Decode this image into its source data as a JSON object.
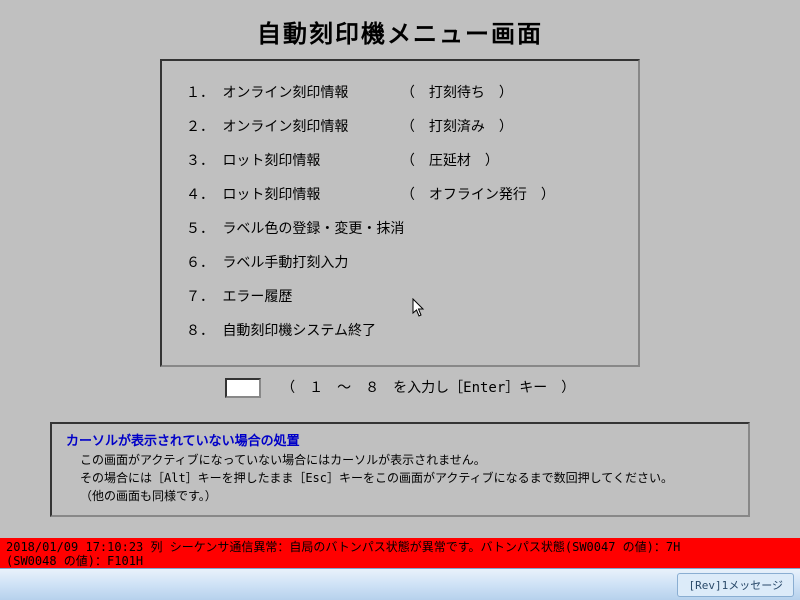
{
  "title": "自動刻印機メニュー画面",
  "menu": [
    {
      "num": "１．",
      "label": "オンライン刻印情報",
      "note": "打刻待ち"
    },
    {
      "num": "２．",
      "label": "オンライン刻印情報",
      "note": "打刻済み"
    },
    {
      "num": "３．",
      "label": "ロット刻印情報",
      "note": "圧延材"
    },
    {
      "num": "４．",
      "label": "ロット刻印情報",
      "note": "オフライン発行"
    },
    {
      "num": "５．",
      "label": "ラベル色の登録・変更・抹消",
      "note": null
    },
    {
      "num": "６．",
      "label": "ラベル手動打刻入力",
      "note": null
    },
    {
      "num": "７．",
      "label": "エラー履歴",
      "note": null
    },
    {
      "num": "８．",
      "label": "自動刻印機システム終了",
      "note": null
    }
  ],
  "input_hint": "（　１　～　８　を入力し［Enter］キー　）",
  "input_value": "",
  "help": {
    "title": "カーソルが表示されていない場合の処置",
    "lines": [
      "この画面がアクティブになっていない場合にはカーソルが表示されません。",
      "その場合には［Alt］キーを押したまま［Esc］キーをこの画面がアクティブになるまで数回押してください。",
      "（他の画面も同様です。）"
    ]
  },
  "alarm": {
    "line1": "2018/01/09 17:10:23 列 シーケンサ通信異常：自局のバトンパス状態が異常です。バトンパス状態(SW0047 の値)：7H",
    "line2": "(SW0048 の値)：F101H"
  },
  "taskbar_item": "[Rev]1メッセージ"
}
